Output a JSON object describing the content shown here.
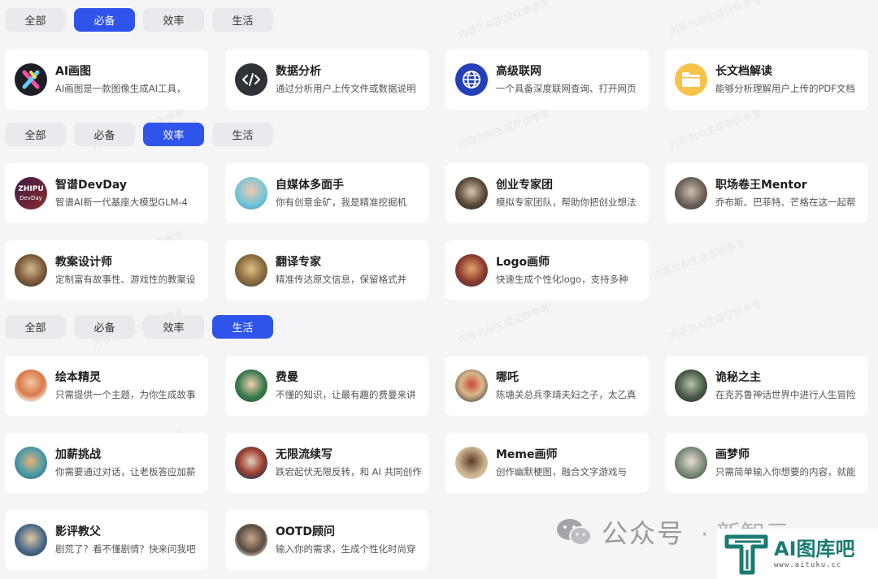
{
  "sections": [
    {
      "tabs": [
        {
          "label": "全部",
          "active": false
        },
        {
          "label": "必备",
          "active": true
        },
        {
          "label": "效率",
          "active": false
        },
        {
          "label": "生活",
          "active": false
        }
      ],
      "cards": [
        {
          "title": "AI画图",
          "desc": "AI画图是一款图像生成AI工具，",
          "icon": "ai-paint-icon"
        },
        {
          "title": "数据分析",
          "desc": "通过分析用户上传文件或数据说明",
          "icon": "code-icon"
        },
        {
          "title": "高级联网",
          "desc": "一个具备深度联网查询、打开网页",
          "icon": "globe-icon"
        },
        {
          "title": "长文档解读",
          "desc": "能够分析理解用户上传的PDF文档",
          "icon": "folder-icon"
        }
      ]
    },
    {
      "tabs": [
        {
          "label": "全部",
          "active": false
        },
        {
          "label": "必备",
          "active": false
        },
        {
          "label": "效率",
          "active": true
        },
        {
          "label": "生活",
          "active": false
        }
      ],
      "cards": [
        {
          "title": "智谱DevDay",
          "desc": "智谱AI新一代基座大模型GLM-4",
          "icon": "zhipu-devday-avatar"
        },
        {
          "title": "自媒体多面手",
          "desc": "你有创意金矿，我是精准挖掘机",
          "icon": "media-avatar"
        },
        {
          "title": "创业专家团",
          "desc": "模拟专家团队，帮助你把创业想法",
          "icon": "startup-avatar"
        },
        {
          "title": "职场卷王Mentor",
          "desc": "乔布斯、巴菲特、芒格在这一起帮",
          "icon": "mentor-avatar"
        },
        {
          "title": "教案设计师",
          "desc": "定制富有故事性、游戏性的教案设",
          "icon": "lesson-avatar"
        },
        {
          "title": "翻译专家",
          "desc": "精准传达原文信息，保留格式并",
          "icon": "translate-avatar"
        },
        {
          "title": "Logo画师",
          "desc": "快速生成个性化logo，支持多种",
          "icon": "logo-avatar"
        }
      ]
    },
    {
      "tabs": [
        {
          "label": "全部",
          "active": false
        },
        {
          "label": "必备",
          "active": false
        },
        {
          "label": "效率",
          "active": false
        },
        {
          "label": "生活",
          "active": true
        }
      ],
      "cards": [
        {
          "title": "绘本精灵",
          "desc": "只需提供一个主题，为你生成故事",
          "icon": "picturebook-avatar"
        },
        {
          "title": "费曼",
          "desc": "不懂的知识，让最有趣的费曼来讲",
          "icon": "feynman-avatar"
        },
        {
          "title": "哪吒",
          "desc": "陈塘关总兵李靖夫妇之子，太乙真",
          "icon": "nezha-avatar"
        },
        {
          "title": "诡秘之主",
          "desc": "在克苏鲁神话世界中进行人生冒险",
          "icon": "mystery-avatar"
        },
        {
          "title": "加薪挑战",
          "desc": "你需要通过对话，让老板答应加薪",
          "icon": "raise-avatar"
        },
        {
          "title": "无限流续写",
          "desc": "跌宕起伏无限反转，和 AI 共同创作",
          "icon": "infinite-avatar"
        },
        {
          "title": "Meme画师",
          "desc": "创作幽默梗图，融合文字游戏与",
          "icon": "meme-avatar"
        },
        {
          "title": "画梦师",
          "desc": "只需简单输入你想要的内容，就能",
          "icon": "dream-avatar"
        },
        {
          "title": "影评教父",
          "desc": "剧荒了？看不懂剧情？快来问我吧",
          "icon": "film-avatar"
        },
        {
          "title": "OOTD顾问",
          "desc": "输入你的需求，生成个性化时尚穿",
          "icon": "ootd-avatar"
        }
      ]
    }
  ],
  "watermark": {
    "line1": "内容为AI生成仅供参考",
    "line2": "158****9100"
  },
  "footer": {
    "wechat_label": "公众号",
    "wechat_extra": "· 新智元",
    "brand_name": "AI图库吧",
    "brand_url": "www.aituku.cc"
  },
  "colors": {
    "accent": "#2f54eb",
    "brand": "#1c7b73",
    "card": "#ffffff",
    "background": "#f5f5f7"
  }
}
